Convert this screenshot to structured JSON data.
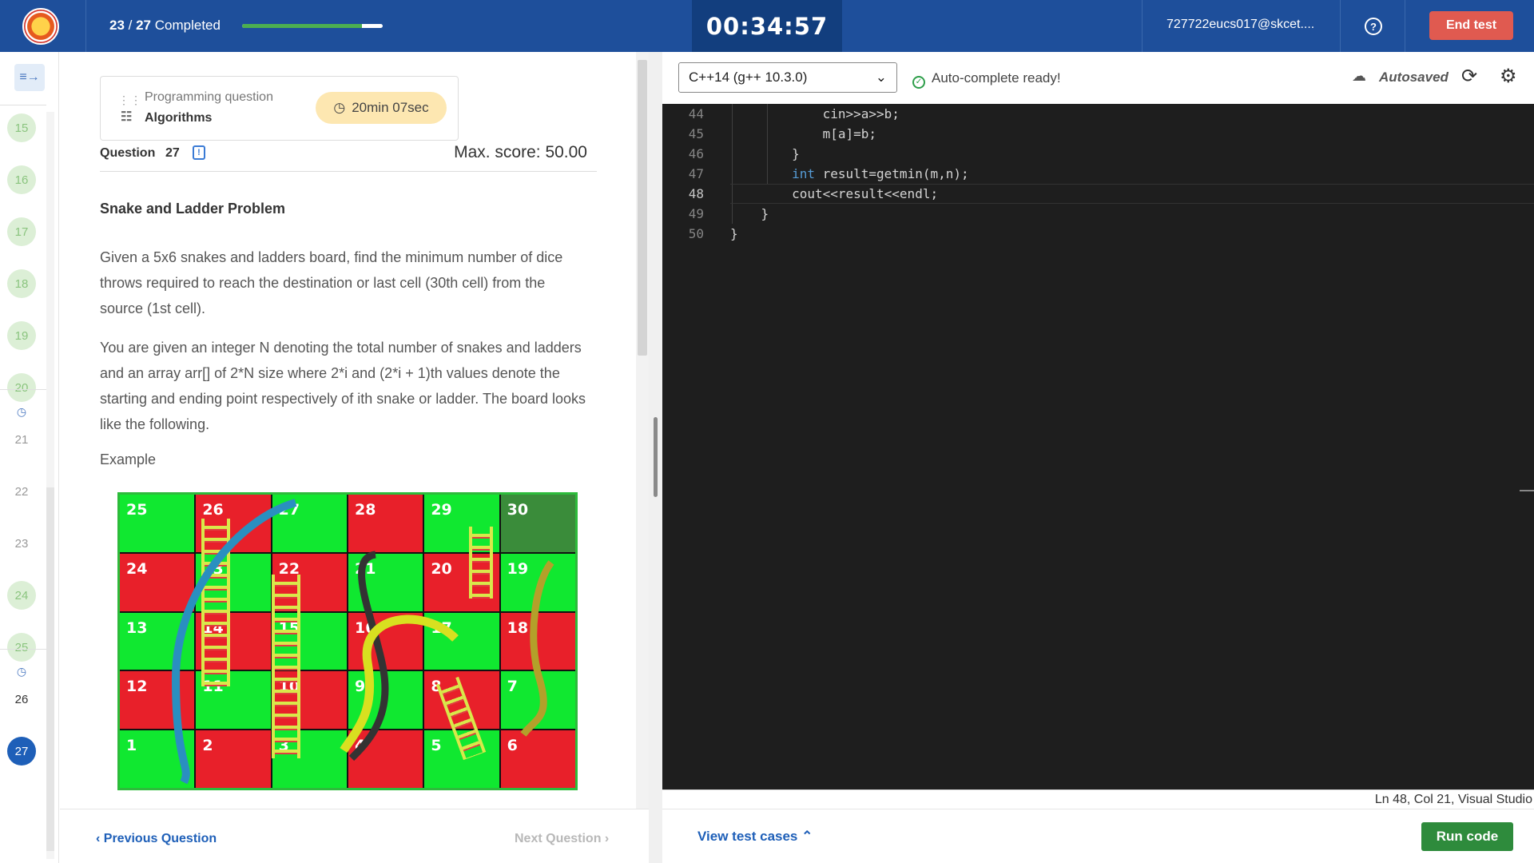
{
  "header": {
    "completed_count": "23",
    "total_count": "27",
    "completed_label": "Completed",
    "progress_fraction": 0.85,
    "timer": "00:34:57",
    "user_email": "727722eucs017@skcet....",
    "end_test_label": "End test"
  },
  "sidebar": {
    "questions": [
      {
        "number": "15",
        "state": "answered"
      },
      {
        "number": "16",
        "state": "answered"
      },
      {
        "number": "17",
        "state": "answered"
      },
      {
        "number": "18",
        "state": "answered"
      },
      {
        "number": "19",
        "state": "answered"
      },
      {
        "number": "20",
        "state": "answered"
      },
      {
        "number": "21",
        "state": "timed"
      },
      {
        "number": "22",
        "state": "unanswered"
      },
      {
        "number": "23",
        "state": "unanswered"
      },
      {
        "number": "24",
        "state": "answered"
      },
      {
        "number": "25",
        "state": "answered"
      },
      {
        "number": "26",
        "state": "timed"
      },
      {
        "number": "27",
        "state": "current"
      }
    ]
  },
  "question": {
    "type_label": "Programming question",
    "topic": "Algorithms",
    "time_left": "20min 07sec",
    "question_label": "Question",
    "question_number": "27",
    "max_score": "Max. score: 50.00",
    "title": "Snake and Ladder Problem",
    "para1": "Given a 5x6 snakes and ladders board, find the minimum number of dice throws required to reach the destination or last cell (30th cell) from the source (1st cell).",
    "para2": "You are given an integer N denoting the total number of snakes and ladders and an array arr[] of 2*N size where 2*i and (2*i + 1)th values denote the starting and ending point respectively of ith snake or ladder. The board looks like the following.",
    "example_label": "Example",
    "board_cells": [
      "25",
      "26",
      "27",
      "28",
      "29",
      "30",
      "24",
      "23",
      "22",
      "21",
      "20",
      "19",
      "13",
      "14",
      "15",
      "16",
      "17",
      "18",
      "12",
      "11",
      "10",
      "9",
      "8",
      "7",
      "1",
      "2",
      "3",
      "4",
      "5",
      "6"
    ],
    "prev_label": "Previous Question",
    "next_label": "Next Question"
  },
  "editor": {
    "language": "C++14 (g++ 10.3.0)",
    "autocomplete_status": "Auto-complete ready!",
    "autosaved_label": "Autosaved",
    "current_line": 48,
    "lines": [
      {
        "n": "44",
        "code": "            cin>>a>>b;"
      },
      {
        "n": "45",
        "code": "            m[a]=b;"
      },
      {
        "n": "46",
        "code": "        }"
      },
      {
        "n": "47",
        "code": "        int result=getmin(m,n);"
      },
      {
        "n": "48",
        "code": "        cout<<result<<endl;"
      },
      {
        "n": "49",
        "code": "    }"
      },
      {
        "n": "50",
        "code": "}"
      }
    ],
    "status_text": "Ln 48, Col 21, Visual Studio",
    "view_test_cases_label": "View test cases",
    "run_code_label": "Run code"
  }
}
